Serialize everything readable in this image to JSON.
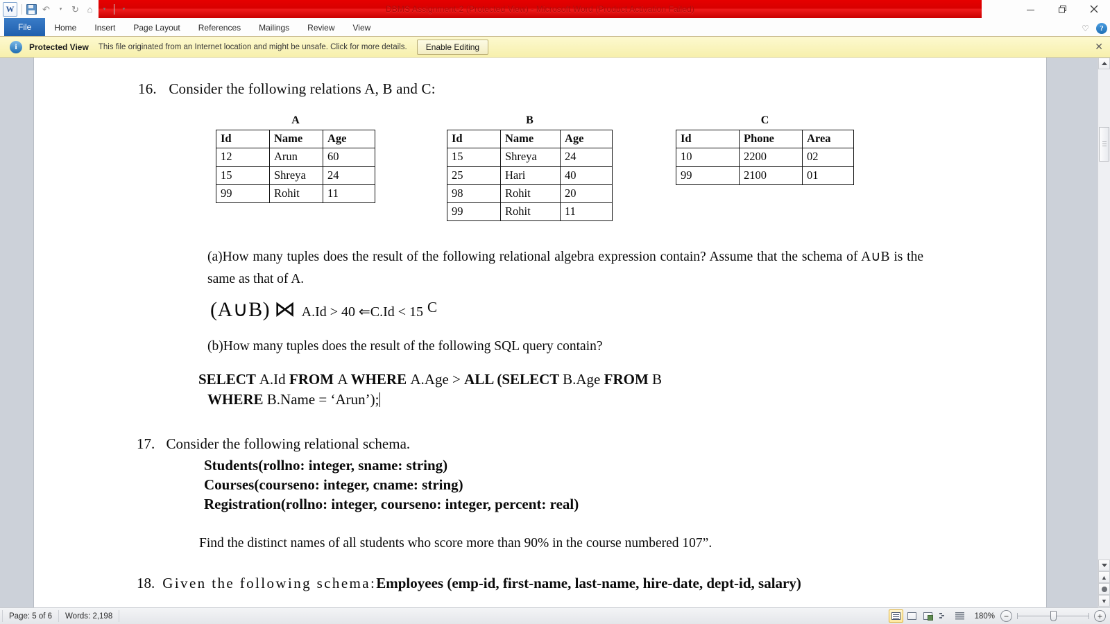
{
  "window": {
    "title": "DBMS Assignment-2 (Protected View)  -  Microsoft Word (Product Activation Failed)",
    "minimize_label": "Minimize",
    "restore_label": "Restore Down",
    "close_label": "Close"
  },
  "quick_access": {
    "app_logo": "W",
    "items": [
      {
        "name": "save-button",
        "glyph": ""
      },
      {
        "name": "undo-button",
        "glyph": "↶"
      },
      {
        "name": "undo-dropdown",
        "glyph": "▾"
      },
      {
        "name": "redo-button",
        "glyph": "↻"
      },
      {
        "name": "print-preview-button",
        "glyph": "⌂"
      },
      {
        "name": "print-preview-dropdown",
        "glyph": "▾"
      },
      {
        "name": "customize-qat-button",
        "glyph": "▾"
      }
    ]
  },
  "ribbon": {
    "tabs": [
      {
        "label": "File",
        "active": true
      },
      {
        "label": "Home",
        "active": false
      },
      {
        "label": "Insert",
        "active": false
      },
      {
        "label": "Page Layout",
        "active": false
      },
      {
        "label": "References",
        "active": false
      },
      {
        "label": "Mailings",
        "active": false
      },
      {
        "label": "Review",
        "active": false
      },
      {
        "label": "View",
        "active": false
      }
    ],
    "minimize_ribbon_glyph": "♡",
    "help_glyph": "?"
  },
  "protected_view": {
    "shield_glyph": "i",
    "title": "Protected View",
    "message": "This file originated from an Internet location and might be unsafe. Click for more details.",
    "button_label": "Enable Editing",
    "close_glyph": "✕"
  },
  "document": {
    "q16": {
      "number": "16.",
      "text": "Consider the following relations  A, B and C:"
    },
    "tables": [
      {
        "name": "A",
        "headers": [
          "Id",
          "Name",
          "Age"
        ],
        "rows": [
          [
            "12",
            "Arun",
            "60"
          ],
          [
            "15",
            "Shreya",
            "24"
          ],
          [
            "99",
            "Rohit",
            "11"
          ]
        ]
      },
      {
        "name": "B",
        "headers": [
          "Id",
          "Name",
          "Age"
        ],
        "rows": [
          [
            "15",
            "Shreya",
            "24"
          ],
          [
            "25",
            "Hari",
            "40"
          ],
          [
            "98",
            "Rohit",
            "20"
          ],
          [
            "99",
            "Rohit",
            "11"
          ]
        ]
      },
      {
        "name": "C",
        "headers": [
          "Id",
          "Phone",
          "Area"
        ],
        "rows": [
          [
            "10",
            "2200",
            "02"
          ],
          [
            "99",
            "2100",
            "01"
          ]
        ]
      }
    ],
    "part_a": "(a)How many tuples does the result of the following relational algebra expression contain?  Assume that the schema of A∪B is the same as that of A.",
    "formula": {
      "left": "(A∪B)",
      "join": "⋈",
      "condition": "A.Id > 40 ⇐C.Id < 15",
      "right": "C"
    },
    "part_b": "(b)How many tuples does the result of the following  SQL query contain?",
    "sql": {
      "line1_parts": [
        {
          "t": "SELECT ",
          "b": true
        },
        {
          "t": "A.Id ",
          "b": false
        },
        {
          "t": "FROM ",
          "b": true
        },
        {
          "t": "A ",
          "b": false
        },
        {
          "t": "WHERE ",
          "b": true
        },
        {
          "t": "A.Age > ",
          "b": false
        },
        {
          "t": "ALL (SELECT ",
          "b": true
        },
        {
          "t": "B.Age ",
          "b": false
        },
        {
          "t": "FROM ",
          "b": true
        },
        {
          "t": "B",
          "b": false
        }
      ],
      "line2_parts": [
        {
          "t": "WHERE ",
          "b": true
        },
        {
          "t": "B.Name = ‘Arun’);",
          "b": false
        }
      ]
    },
    "q17": {
      "number": "17.",
      "text": "Consider the following relational schema.",
      "schema_lines": [
        "Students(rollno:  integer,  sname:  string)",
        "Courses(courseno:  integer,  cname:  string)",
        "Registration(rollno:  integer,  courseno:  integer,  percent:  real)"
      ],
      "find_text": "Find the distinct names of all students who score more than 90% in the course numbered 107”."
    },
    "q18": {
      "number": "18.",
      "lead": "Given   the   following   schema:",
      "bold_text": "Employees   (emp-id,   first-name,   last-name,   hire-date,   dept-id,   salary)"
    }
  },
  "status_bar": {
    "page": "Page: 5 of 6",
    "words": "Words: 2,198",
    "views": [
      {
        "name": "print-layout-view",
        "active": true
      },
      {
        "name": "full-screen-reading-view",
        "active": false
      },
      {
        "name": "web-layout-view",
        "active": false
      },
      {
        "name": "outline-view",
        "active": false
      },
      {
        "name": "draft-view",
        "active": false
      }
    ],
    "zoom_level": "180%",
    "zoom_out_glyph": "−",
    "zoom_in_glyph": "+"
  },
  "scrollbar": {
    "up_glyph": "▲",
    "down_glyph": "▼",
    "previous_page_glyph": "▴▴",
    "select_browse_object_glyph": "●",
    "next_page_glyph": "▾▾"
  }
}
